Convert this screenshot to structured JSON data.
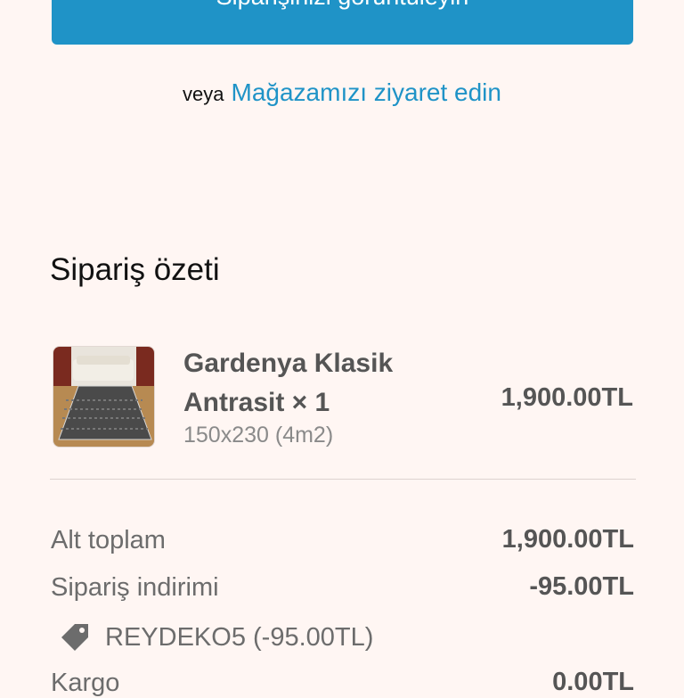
{
  "cta": {
    "label": "Siparişinizi görüntüleyin"
  },
  "alternate": {
    "or_text": "veya",
    "store_link": "Mağazamızı ziyaret edin"
  },
  "summary": {
    "title": "Sipariş özeti",
    "product": {
      "name": "Gardenya Klasik Antrasit × 1",
      "variant": "150x230 (4m2)",
      "price": "1,900.00TL",
      "thumbnail_icon": "rug-product-photo"
    },
    "subtotal": {
      "label": "Alt toplam",
      "value": "1,900.00TL"
    },
    "order_discount": {
      "label": "Sipariş indirimi",
      "value": "-95.00TL"
    },
    "discount_code": {
      "icon": "tag-icon",
      "text": "REYDEKO5 (-95.00TL)"
    },
    "shipping": {
      "label": "Kargo",
      "value": "0.00TL"
    }
  },
  "colors": {
    "accent": "#1f93c7",
    "background": "#fff6f3"
  }
}
